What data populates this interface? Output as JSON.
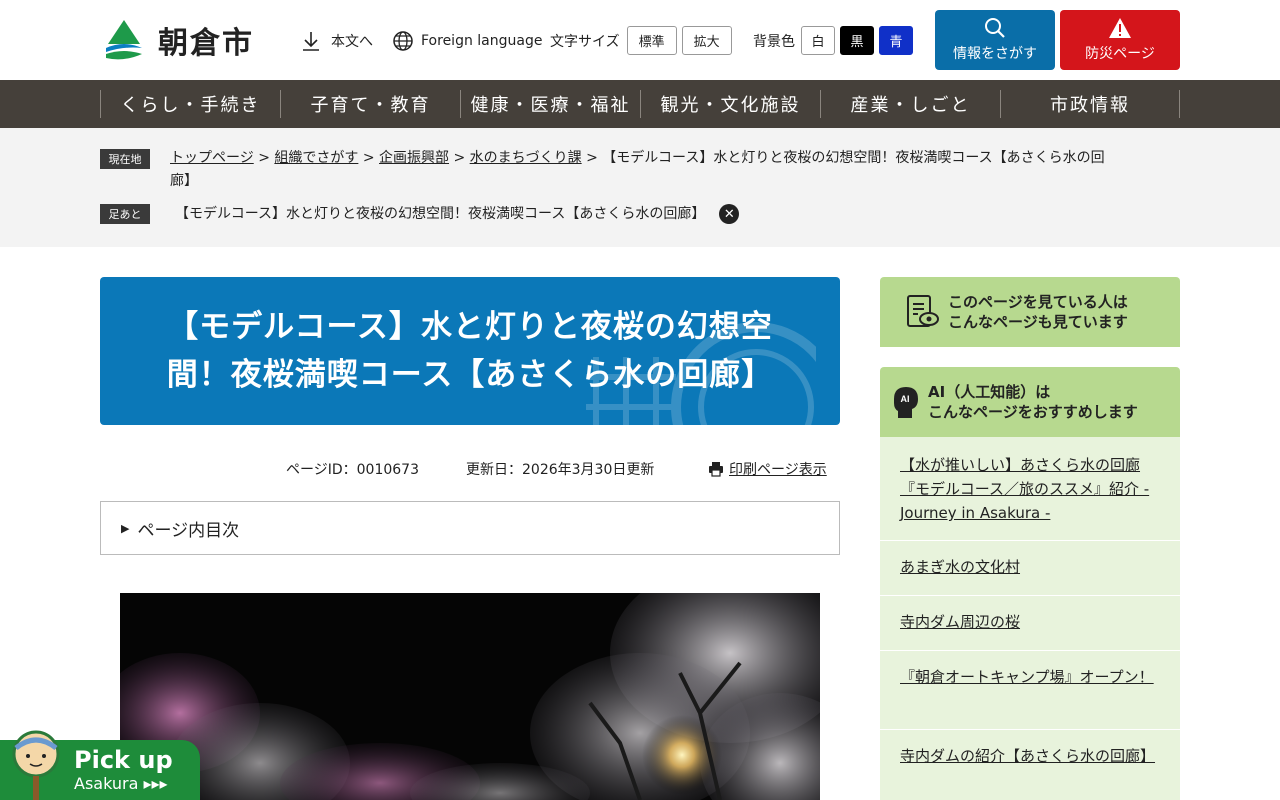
{
  "header": {
    "logo_text": "朝倉市",
    "honbun": "本文へ",
    "foreign": "Foreign language",
    "font_size_label": "文字サイズ",
    "font_size_standard": "標準",
    "font_size_large": "拡大",
    "bg_label": "背景色",
    "bg_white": "白",
    "bg_black": "黒",
    "bg_blue": "青",
    "search_button": "情報をさがす",
    "bousai_button": "防災ページ"
  },
  "nav": {
    "items": [
      "くらし・手続き",
      "子育て・教育",
      "健康・医療・福祉",
      "観光・文化施設",
      "産業・しごと",
      "市政情報"
    ]
  },
  "breadcrumb": {
    "current_tag": "現在地",
    "links": [
      "トップページ",
      "組織でさがす",
      "企画振興部",
      "水のまちづくり課"
    ],
    "separator": ">",
    "current_line1": "【モデルコース】水と灯りと夜桜の幻想空間！夜桜満喫コース【あさくら水の回",
    "current_line2": "廊】",
    "history_tag": "足あと",
    "history_item": "【モデルコース】水と灯りと夜桜の幻想空間！夜桜満喫コース【あさくら水の回廊】"
  },
  "page": {
    "title_line1": "【モデルコース】水と灯りと夜桜の幻想空",
    "title_line2": "間！夜桜満喫コース【あさくら水の回廊】",
    "page_id": "ページID：0010673",
    "updated": "更新日：2026年3月30日更新",
    "print": "印刷ページ表示",
    "toc": "ページ内目次"
  },
  "sidebar": {
    "box1_line1": "このページを見ている人は",
    "box1_line2": "こんなページも見ています",
    "box2_line1": "AI（人工知能）は",
    "box2_line2": "こんなページをおすすめします",
    "ai_icon_text": "AI",
    "links": [
      "【水が推いしい】あさくら水の回廊『モデルコース／旅のススメ』紹介 - Journey in Asakura -",
      "あまぎ水の文化村",
      "寺内ダム周辺の桜",
      "『朝倉オートキャンプ場』オープン！",
      "寺内ダムの紹介【あさくら水の回廊】"
    ]
  },
  "pickup": {
    "title": "Pick up",
    "subtitle": "Asakura ▸▸▸"
  },
  "colors": {
    "nav_bg": "#45403a",
    "title_bg": "#0b78b8",
    "search_btn": "#0a6ea8",
    "bousai_btn": "#d4151b",
    "sidebar_header": "#b7d98f",
    "sidebar_list": "#e8f3dc",
    "pickup_bg": "#1e8c3a"
  }
}
